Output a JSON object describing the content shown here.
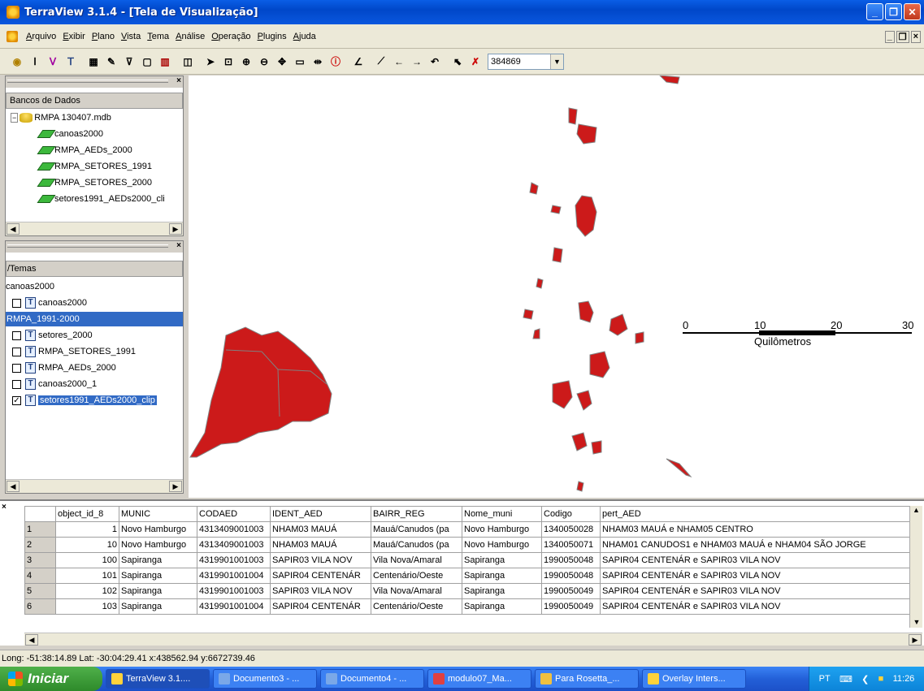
{
  "window": {
    "title": "TerraView 3.1.4 - [Tela de Visualização]"
  },
  "menu": [
    "Arquivo",
    "Exibir",
    "Plano",
    "Vista",
    "Tema",
    "Análise",
    "Operação",
    "Plugins",
    "Ajuda"
  ],
  "toolbar": {
    "scale_value": "384869"
  },
  "db_panel": {
    "header": "Bancos de Dados",
    "database": "RMPA 130407.mdb",
    "layers": [
      "canoas2000",
      "RMPA_AEDs_2000",
      "RMPA_SETORES_1991",
      "RMPA_SETORES_2000",
      "setores1991_AEDs2000_cli"
    ]
  },
  "themes_panel": {
    "header": "/Temas",
    "view1": "canoas2000",
    "view1_themes": [
      {
        "label": "canoas2000",
        "checked": false
      }
    ],
    "view2": "RMPA_1991-2000",
    "view2_themes": [
      {
        "label": "setores_2000",
        "checked": false
      },
      {
        "label": "RMPA_SETORES_1991",
        "checked": false
      },
      {
        "label": "RMPA_AEDs_2000",
        "checked": false
      },
      {
        "label": "canoas2000_1",
        "checked": false
      },
      {
        "label": "setores1991_AEDs2000_clip",
        "checked": true
      }
    ]
  },
  "scalebar": {
    "ticks": [
      "0",
      "10",
      "20",
      "30"
    ],
    "unit": "Quilômetros"
  },
  "colors": {
    "map_fill": "#cc1a1a",
    "selection": "#316ac5"
  },
  "table": {
    "columns": [
      "object_id_8",
      "MUNIC",
      "CODAED",
      "IDENT_AED",
      "BAIRR_REG",
      "Nome_muni",
      "Codigo",
      "pert_AED"
    ],
    "rows": [
      {
        "n": "1",
        "cells": [
          "1",
          "Novo Hamburgo",
          "4313409001003",
          "NHAM03 MAUÁ",
          "Mauá/Canudos (pa",
          "Novo Hamburgo",
          "1340050028",
          "NHAM03 MAUÁ e  NHAM05 CENTRO"
        ]
      },
      {
        "n": "2",
        "cells": [
          "10",
          "Novo Hamburgo",
          "4313409001003",
          "NHAM03 MAUÁ",
          "Mauá/Canudos (pa",
          "Novo Hamburgo",
          "1340050071",
          "NHAM01 CANUDOS1 e NHAM03 MAUÁ e NHAM04 SÃO JORGE"
        ]
      },
      {
        "n": "3",
        "cells": [
          "100",
          "Sapiranga",
          "4319901001003",
          "SAPIR03 VILA NOV",
          "Vila Nova/Amaral",
          "Sapiranga",
          "1990050048",
          "SAPIR04 CENTENÁR e SAPIR03 VILA NOV"
        ]
      },
      {
        "n": "4",
        "cells": [
          "101",
          "Sapiranga",
          "4319901001004",
          "SAPIR04 CENTENÁR",
          "Centenário/Oeste",
          "Sapiranga",
          "1990050048",
          "SAPIR04 CENTENÁR e SAPIR03 VILA NOV"
        ]
      },
      {
        "n": "5",
        "cells": [
          "102",
          "Sapiranga",
          "4319901001003",
          "SAPIR03 VILA NOV",
          "Vila Nova/Amaral",
          "Sapiranga",
          "1990050049",
          "SAPIR04 CENTENÁR e SAPIR03 VILA NOV"
        ]
      },
      {
        "n": "6",
        "cells": [
          "103",
          "Sapiranga",
          "4319901001004",
          "SAPIR04 CENTENÁR",
          "Centenário/Oeste",
          "Sapiranga",
          "1990050049",
          "SAPIR04 CENTENÁR e SAPIR03 VILA NOV"
        ]
      }
    ]
  },
  "status": "Long: -51:38:14.89 Lat: -30:04:29.41 x:438562.94 y:6672739.46",
  "taskbar": {
    "start": "Iniciar",
    "tasks": [
      "TerraView 3.1....",
      "Documento3 - ...",
      "Documento4 - ...",
      "modulo07_Ma...",
      "Para Rosetta_...",
      "Overlay Inters..."
    ],
    "lang": "PT",
    "clock": "11:26"
  }
}
